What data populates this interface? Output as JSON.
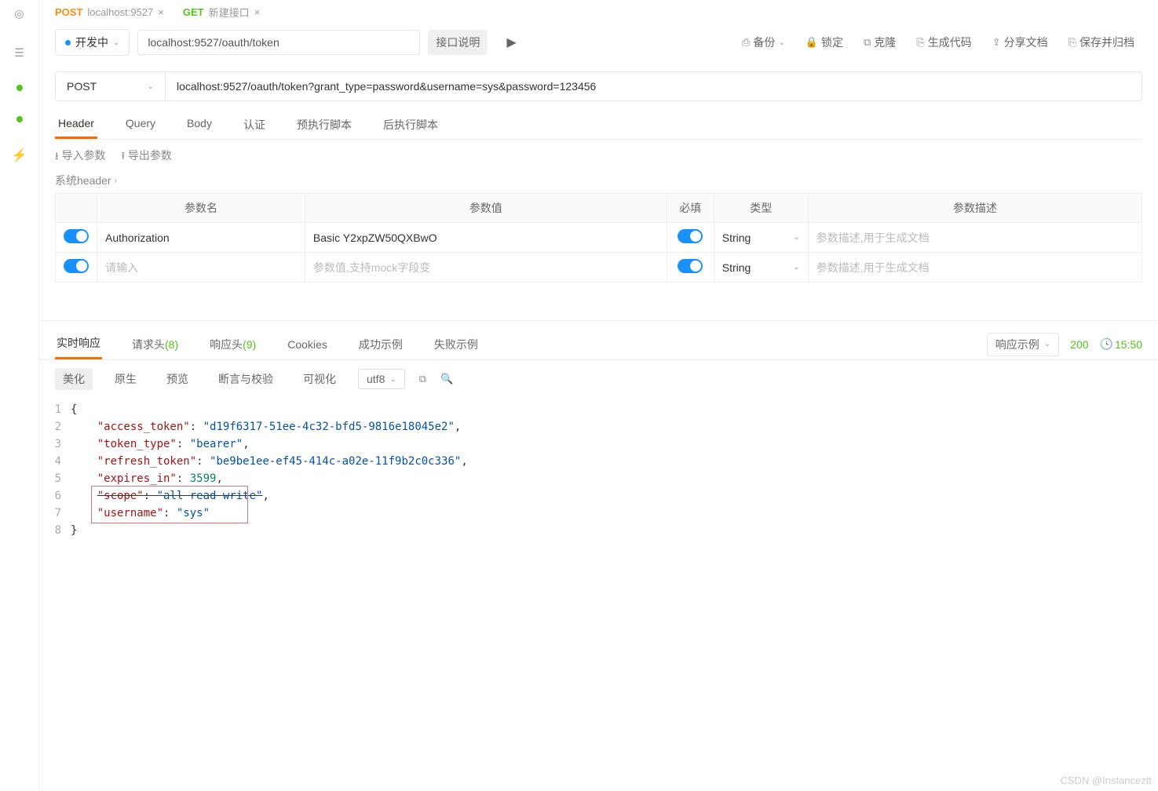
{
  "tabs_top": [
    {
      "method": "POST",
      "label": "localhost:9527",
      "close": "×"
    },
    {
      "method": "GET",
      "label": "新建接口",
      "close": "×"
    }
  ],
  "env": {
    "label": "开发中"
  },
  "url_short": "localhost:9527/oauth/token",
  "toolbar": {
    "desc": "接口说明",
    "backup": "备份",
    "lock": "锁定",
    "clone": "克隆",
    "gencode": "生成代码",
    "share": "分享文档",
    "save": "保存并归档"
  },
  "method": "POST",
  "full_url": "localhost:9527/oauth/token?grant_type=password&username=sys&password=123456",
  "req_tabs": [
    "Header",
    "Query",
    "Body",
    "认证",
    "预执行脚本",
    "后执行脚本"
  ],
  "param_tools": {
    "import": "导入参数",
    "export": "导出参数"
  },
  "sys_header": "系统header",
  "ptable": {
    "headers": [
      "参数名",
      "参数值",
      "必填",
      "类型",
      "参数描述"
    ],
    "rows": [
      {
        "name": "Authorization",
        "value": "Basic Y2xpZW50QXBwO",
        "type": "String",
        "desc_ph": "参数描述,用于生成文档"
      },
      {
        "name_ph": "请输入",
        "value_ph": "参数值,支持mock字段变",
        "type": "String",
        "desc_ph": "参数描述,用于生成文档"
      }
    ]
  },
  "resp_tabs": [
    {
      "label": "实时响应"
    },
    {
      "label": "请求头",
      "count": "(8)"
    },
    {
      "label": "响应头",
      "count": "(9)"
    },
    {
      "label": "Cookies"
    },
    {
      "label": "成功示例"
    },
    {
      "label": "失败示例"
    }
  ],
  "resp_right": {
    "example": "响应示例",
    "status": "200",
    "time": "15:50"
  },
  "resp_tools": [
    "美化",
    "原生",
    "预览",
    "断言与校验",
    "可视化"
  ],
  "encoding": "utf8",
  "json": {
    "lines": [
      "1",
      "2",
      "3",
      "4",
      "5",
      "6",
      "7",
      "8"
    ],
    "access_token": "d19f6317-51ee-4c32-bfd5-9816e18045e2",
    "token_type": "bearer",
    "refresh_token": "be9be1ee-ef45-414c-a02e-11f9b2c0c336",
    "expires_in": "3599",
    "scope": "all read write",
    "username": "sys"
  },
  "watermark": "CSDN @Instanceztt"
}
